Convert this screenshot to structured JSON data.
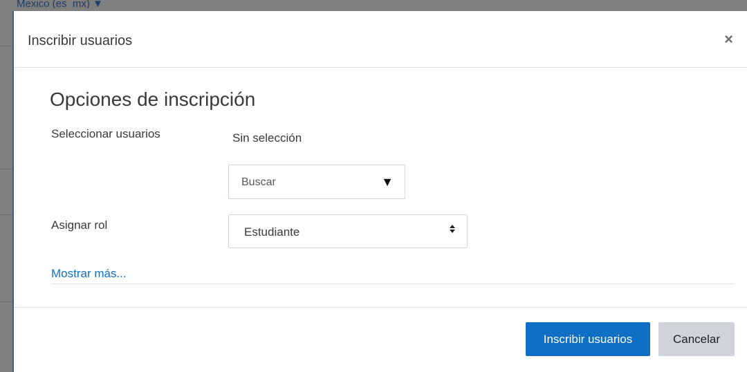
{
  "background": {
    "top_text": "Mexico (es_mx) ▼"
  },
  "modal": {
    "title": "Inscribir usuarios",
    "close_glyph": "×"
  },
  "form": {
    "section_title": "Opciones de inscripción",
    "select_users_label": "Seleccionar usuarios",
    "selection_value": "Sin selección",
    "search_placeholder": "Buscar",
    "search_arrow_glyph": "▼",
    "assign_role_label": "Asignar rol",
    "role_selected": "Estudiante",
    "role_arrows_glyph": "⬍",
    "show_more_link": "Mostrar más..."
  },
  "footer": {
    "primary_label": "Inscribir usuarios",
    "cancel_label": "Cancelar"
  },
  "colors": {
    "primary": "#0f6fc5",
    "secondary": "#ced4da",
    "link": "#0f6fc5"
  },
  "icons": {
    "close": "close-icon",
    "dropdown": "caret-down-icon",
    "select": "sort-arrows-icon"
  }
}
